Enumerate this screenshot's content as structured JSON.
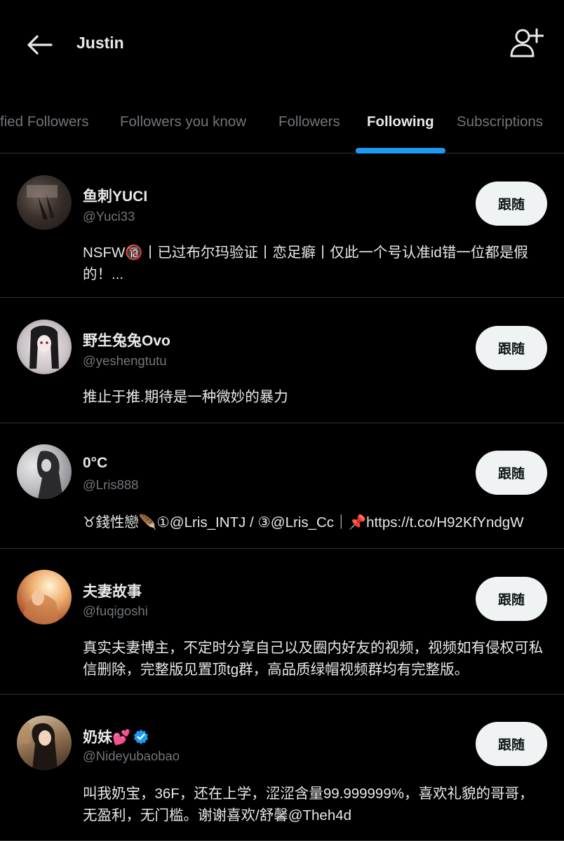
{
  "header": {
    "title": "Justin"
  },
  "tabs": [
    {
      "label": "fied Followers"
    },
    {
      "label": "Followers you know"
    },
    {
      "label": "Followers"
    },
    {
      "label": "Following"
    },
    {
      "label": "Subscriptions"
    }
  ],
  "colors": {
    "accent": "#1d9bf0",
    "background": "#000000",
    "muted_text": "#71767b",
    "button_bg": "#eff3f4"
  },
  "users": [
    {
      "name": "鱼刺YUCI",
      "handle": "@Yuci33",
      "bio": "NSFW🔞丨已过布尔玛验证丨恋足癖丨仅此一个号认准id错一位都是假的！...",
      "follow_label": "跟随",
      "verified": false
    },
    {
      "name": "野生兔兔Ovo",
      "handle": "@yeshengtutu",
      "bio": "推止于推.期待是一种微妙的暴力",
      "follow_label": "跟随",
      "verified": false
    },
    {
      "name": "0°C",
      "handle": "@Lris888",
      "bio": "♉錢性戀🪶①@Lris_INTJ / ③@Lris_Cc｜📌https://t.co/H92KfYndgW",
      "follow_label": "跟随",
      "verified": false
    },
    {
      "name": "夫妻故事",
      "handle": "@fuqigoshi",
      "bio": "真实夫妻博主，不定时分享自己以及圈内好友的视频，视频如有侵权可私信删除，完整版见置顶tg群，高品质绿帽视频群均有完整版。",
      "follow_label": "跟随",
      "verified": false
    },
    {
      "name": "奶妹💕",
      "handle": "@Nideyubaobao",
      "bio": "叫我奶宝，36F，还在上学，涩涩含量99.999999%，喜欢礼貌的哥哥，无盈利，无门槛。谢谢喜欢/舒馨@Theh4d",
      "follow_label": "跟随",
      "verified": true
    }
  ]
}
